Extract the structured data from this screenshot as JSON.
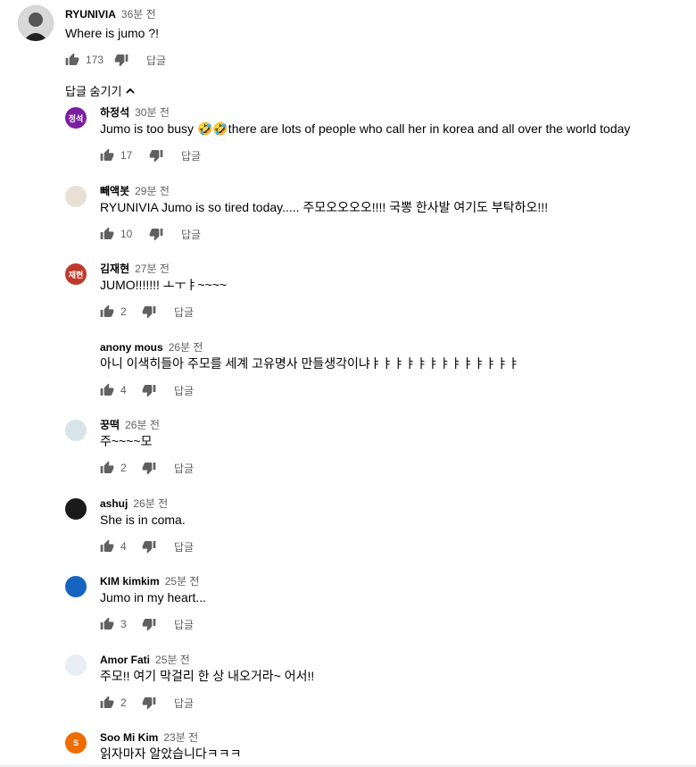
{
  "main_comment": {
    "author": "RYUNIVIA",
    "time": "36분 전",
    "text": "Where is jumo ?!",
    "likes": "173",
    "reply_label": "답글"
  },
  "hide_replies_label": "답글 숨기기",
  "replies": [
    {
      "author": "하정석",
      "time": "30분 전",
      "text": "Jumo is too busy 🤣🤣there are lots of people who call her in korea and all over the world today",
      "likes": "17",
      "reply_label": "답글",
      "avatar_text": "정석",
      "avatar_color": "#7b1fa2"
    },
    {
      "author": "빼액봇",
      "time": "29분 전",
      "text": "RYUNIVIA Jumo is so tired today..... 주모오오오오!!!! 국뽕 한사발 여기도 부탁하오!!!",
      "likes": "10",
      "reply_label": "답글",
      "avatar_text": "",
      "avatar_color": "#e8e0d4"
    },
    {
      "author": "김재현",
      "time": "27분 전",
      "text": "JUMO!!!!!!! ㅗㅜㅑ~~~~",
      "likes": "2",
      "reply_label": "답글",
      "avatar_text": "재현",
      "avatar_color": "#c0392b"
    },
    {
      "author": "anony mous",
      "time": "26분 전",
      "text": "아니 이색히들아 주모를 세계 고유명사 만들생각이냐ㅑㅑㅑㅑㅑㅑㅑㅑㅑㅑㅑㅑㅑ",
      "likes": "4",
      "reply_label": "답글",
      "avatar_text": "",
      "avatar_color": "#ffffff"
    },
    {
      "author": "꿍떡",
      "time": "26분 전",
      "text": "주~~~~모",
      "likes": "2",
      "reply_label": "답글",
      "avatar_text": "",
      "avatar_color": "#d9e3ea"
    },
    {
      "author": "ashuj",
      "time": "26분 전",
      "text": "She is in coma.",
      "likes": "4",
      "reply_label": "답글",
      "avatar_text": "",
      "avatar_color": "#1a1a1a"
    },
    {
      "author": "KIM kimkim",
      "time": "25분 전",
      "text": "Jumo in my heart...",
      "likes": "3",
      "reply_label": "답글",
      "avatar_text": "",
      "avatar_color": "#1565c0"
    },
    {
      "author": "Amor Fati",
      "time": "25분 전",
      "text": "주모!! 여기 막걸리 한 상 내오거라~ 어서!!",
      "likes": "2",
      "reply_label": "답글",
      "avatar_text": "",
      "avatar_color": "#e9eef5"
    },
    {
      "author": "Soo Mi Kim",
      "time": "23분 전",
      "text": "읽자마자 알았습니다ㅋㅋㅋ",
      "likes": "",
      "reply_label": "",
      "avatar_text": "S",
      "avatar_color": "#ef6c00"
    }
  ]
}
